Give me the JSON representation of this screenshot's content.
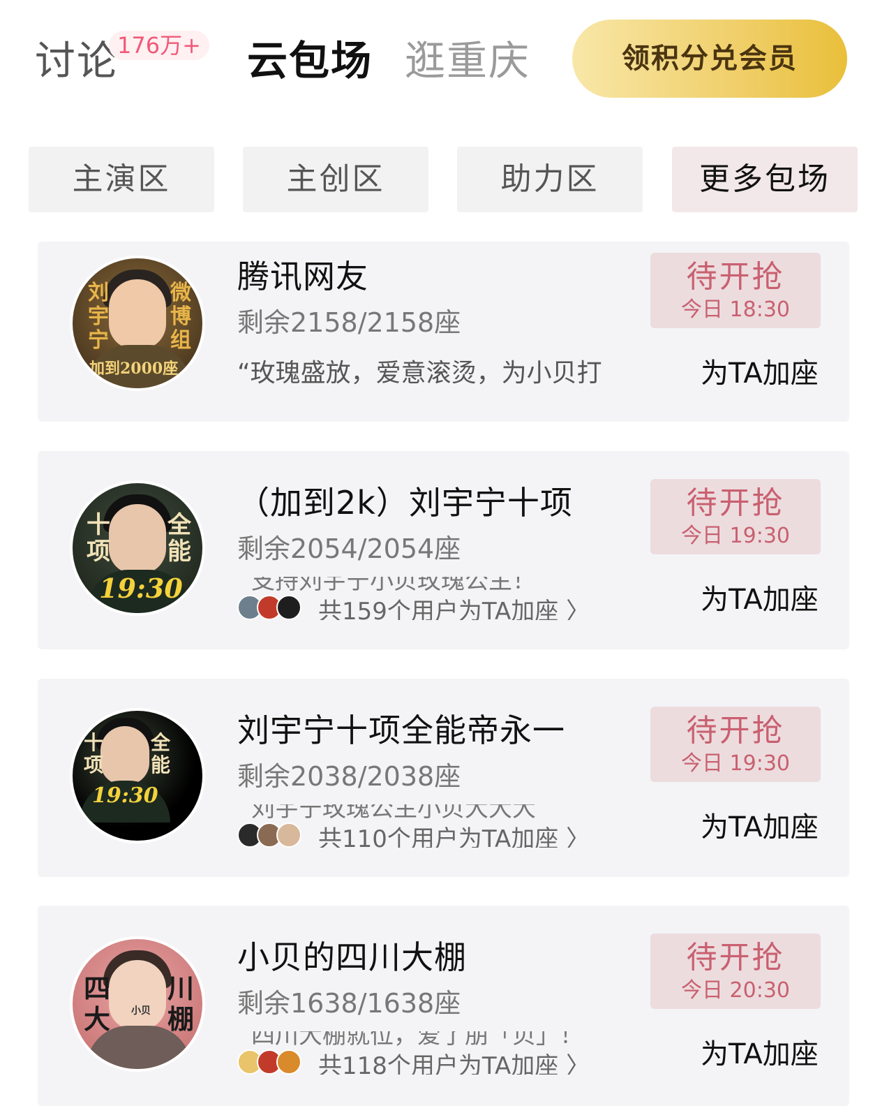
{
  "header": {
    "tabs": [
      {
        "label": "讨论",
        "badge": "176万+"
      },
      {
        "label": "云包场"
      },
      {
        "label": "逛重庆"
      }
    ],
    "vip_button": "领积分兑会员"
  },
  "subtabs": [
    "主演区",
    "主创区",
    "助力区",
    "更多包场"
  ],
  "cards": [
    {
      "title": "腾讯网友",
      "seats": "剩余2158/2158座",
      "desc": "“玫瑰盛放，爱意滚烫，为小贝打",
      "avatar_text": [
        "刘",
        "宇",
        "宁",
        "微",
        "博",
        "组",
        "加到2000座"
      ],
      "status": "待开抢",
      "time": "今日 18:30",
      "add_seat": "为TA加座"
    },
    {
      "title": "（加到2k）刘宇宁十项",
      "seats": "剩余2054/2054座",
      "ticker_line1": "支持刘宇宁小贝玫瑰公主！",
      "ticker_line2": "共159个用户为TA加座 〉",
      "avatar_text": [
        "十",
        "项",
        "全",
        "能",
        "19:30"
      ],
      "status": "待开抢",
      "time": "今日 19:30",
      "add_seat": "为TA加座"
    },
    {
      "title": "刘宇宁十项全能帝永一",
      "seats": "剩余2038/2038座",
      "ticker_line1": "刘宇宁玫瑰公主小贝大大大",
      "ticker_line2": "共110个用户为TA加座 〉",
      "avatar_text": [
        "十",
        "项",
        "全",
        "能",
        "19:30"
      ],
      "status": "待开抢",
      "time": "今日 19:30",
      "add_seat": "为TA加座"
    },
    {
      "title": "小贝的四川大棚",
      "seats": "剩余1638/1638座",
      "ticker_line1": "四川大棚就位，爱了朋「贝」！",
      "ticker_line2": "共118个用户为TA加座 〉",
      "avatar_text": [
        "四",
        "大",
        "川",
        "棚",
        "小贝"
      ],
      "status": "待开抢",
      "time": "今日 20:30",
      "add_seat": "为TA加座"
    }
  ]
}
